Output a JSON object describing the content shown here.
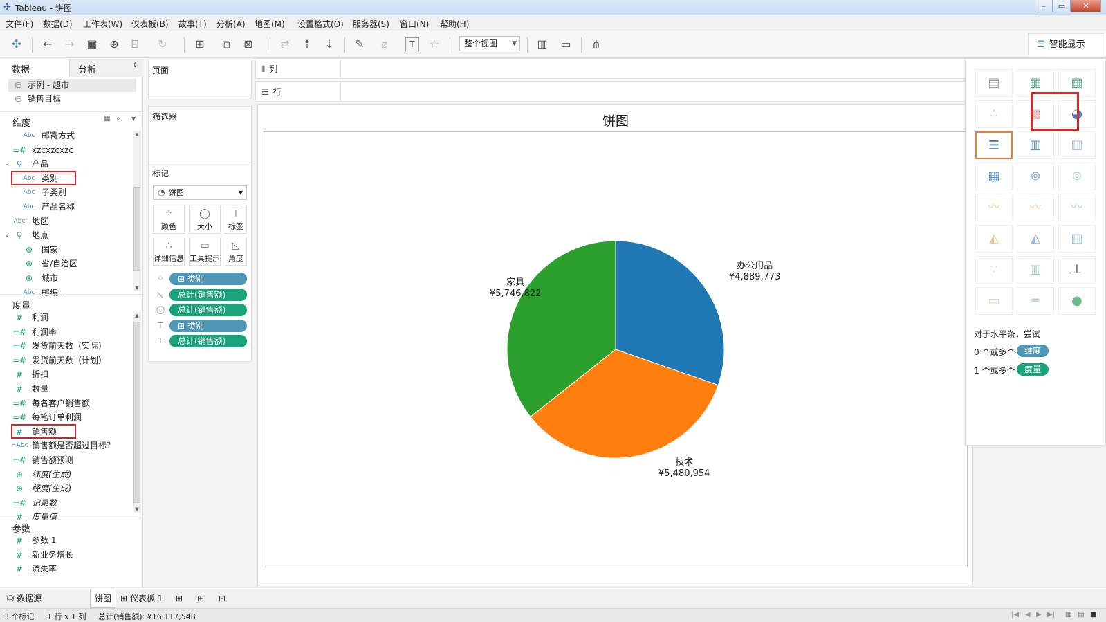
{
  "window": {
    "title": "Tableau - 饼图",
    "buttons": [
      "–",
      "▭",
      "✕"
    ]
  },
  "menu": [
    "文件(F)",
    "数据(D)",
    "工作表(W)",
    "仪表板(B)",
    "故事(T)",
    "分析(A)",
    "地图(M)",
    "设置格式(O)",
    "服务器(S)",
    "窗口(N)",
    "帮助(H)"
  ],
  "toolbar": {
    "fit_value": "整个视图",
    "showme_label": "智能显示"
  },
  "data_pane": {
    "tabs": [
      "数据",
      "分析"
    ],
    "datasources": [
      "示例 - 超市",
      "销售目标"
    ],
    "dimensions_header": "维度",
    "dimensions": [
      {
        "type": "Abc",
        "label": "邮寄方式",
        "indent": 2
      },
      {
        "type": "=#",
        "label": "xzcxzcxzc",
        "indent": 1
      },
      {
        "type": "hier",
        "label": "产品",
        "indent": 1,
        "expanded": true
      },
      {
        "type": "Abc",
        "label": "类别",
        "indent": 2,
        "highlighted": true
      },
      {
        "type": "Abc",
        "label": "子类别",
        "indent": 2
      },
      {
        "type": "Abc",
        "label": "产品名称",
        "indent": 2
      },
      {
        "type": "Abc",
        "label": "地区",
        "indent": 1
      },
      {
        "type": "hier",
        "label": "地点",
        "indent": 1,
        "expanded": true
      },
      {
        "type": "geo",
        "label": "国家",
        "indent": 2
      },
      {
        "type": "geo",
        "label": "省/自治区",
        "indent": 2
      },
      {
        "type": "geo",
        "label": "城市",
        "indent": 2
      },
      {
        "type": "Abc",
        "label": "邮编…",
        "indent": 2
      }
    ],
    "measures_header": "度量",
    "measures": [
      {
        "type": "#",
        "label": "利润",
        "italic": false
      },
      {
        "type": "=#",
        "label": "利润率",
        "italic": false
      },
      {
        "type": "=#",
        "label": "发货前天数（实际）",
        "italic": false
      },
      {
        "type": "=#",
        "label": "发货前天数（计划）",
        "italic": false
      },
      {
        "type": "#",
        "label": "折扣",
        "italic": false
      },
      {
        "type": "#",
        "label": "数量",
        "italic": false
      },
      {
        "type": "=#",
        "label": "每名客户销售额",
        "italic": false
      },
      {
        "type": "=#",
        "label": "每笔订单利润",
        "italic": false
      },
      {
        "type": "#",
        "label": "销售额",
        "italic": false,
        "highlighted": true
      },
      {
        "type": "=Abc",
        "label": "销售额是否超过目标？",
        "italic": false
      },
      {
        "type": "=#",
        "label": "销售额预测",
        "italic": false
      },
      {
        "type": "geo",
        "label": "纬度(生成)",
        "italic": true
      },
      {
        "type": "geo",
        "label": "经度(生成)",
        "italic": true
      },
      {
        "type": "=#",
        "label": "记录数",
        "italic": true
      },
      {
        "type": "#",
        "label": "度量值",
        "italic": true
      }
    ],
    "params_header": "参数",
    "params": [
      {
        "type": "#",
        "label": "参数 1"
      },
      {
        "type": "#",
        "label": "新业务增长"
      },
      {
        "type": "#",
        "label": "流失率"
      }
    ]
  },
  "cards": {
    "pages": "页面",
    "filters": "筛选器",
    "marks": "标记",
    "mark_type": "饼图",
    "mark_buttons": [
      "颜色",
      "大小",
      "标签",
      "详细信息",
      "工具提示",
      "角度"
    ],
    "pills": [
      {
        "icon": "color",
        "label": "⊞ 类别",
        "kind": "dimension"
      },
      {
        "icon": "angle",
        "label": "总计(销售额)",
        "kind": "measure"
      },
      {
        "icon": "size",
        "label": "总计(销售额)",
        "kind": "measure"
      },
      {
        "icon": "label",
        "label": "⊞ 类别",
        "kind": "dimension"
      },
      {
        "icon": "label",
        "label": "总计(销售额)",
        "kind": "measure"
      }
    ]
  },
  "shelves": {
    "columns": "列",
    "rows": "行"
  },
  "view": {
    "title": "饼图"
  },
  "chart_data": {
    "type": "pie",
    "title": "饼图",
    "slices": [
      {
        "category": "办公用品",
        "value": 4889773,
        "label": "¥4,889,773",
        "color": "#1f77b4"
      },
      {
        "category": "技术",
        "value": 5480954,
        "label": "¥5,480,954",
        "color": "#ff7f0e"
      },
      {
        "category": "家具",
        "value": 5746822,
        "label": "¥5,746,822",
        "color": "#2ca02c"
      }
    ]
  },
  "show_me": {
    "hint_title": "对于水平条，尝试",
    "req1_text": "0 个或多个",
    "req1_pill": "维度",
    "req2_text": "1 个或多个",
    "req2_pill": "度量",
    "colors": {
      "dimension": "#4f97b7",
      "measure": "#1aa37a",
      "highlight": "#d62728",
      "active": "#e87d3e"
    }
  },
  "bottom_tabs": {
    "datasource": "数据源",
    "sheets": [
      "饼图",
      "仪表板 1"
    ]
  },
  "status": {
    "marks": "3 个标记",
    "dims": "1 行 x 1 列",
    "sum": "总计(销售额): ¥16,117,548"
  }
}
